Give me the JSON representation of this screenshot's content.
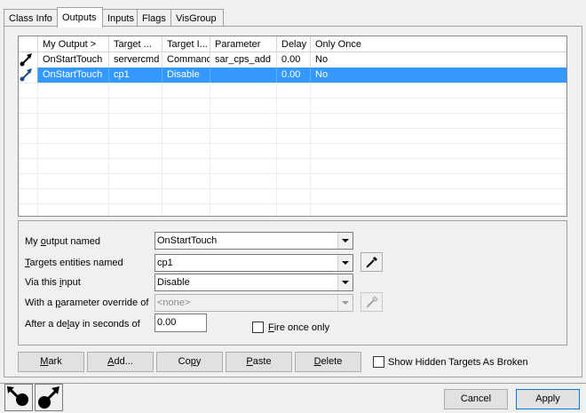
{
  "tabs": [
    {
      "label": "Class Info"
    },
    {
      "label": "Outputs"
    },
    {
      "label": "Inputs"
    },
    {
      "label": "Flags"
    },
    {
      "label": "VisGroup"
    }
  ],
  "active_tab": "Outputs",
  "list": {
    "columns": [
      "",
      "My Output  >",
      "Target ...",
      "Target I...",
      "Parameter",
      "Delay",
      "Only Once"
    ],
    "rows": [
      {
        "output": "OnStartTouch",
        "target": "servercmd",
        "input": "Command",
        "parameter": "sar_cps_add",
        "delay": "0.00",
        "once": "No",
        "selected": false
      },
      {
        "output": "OnStartTouch",
        "target": "cp1",
        "input": "Disable",
        "parameter": "",
        "delay": "0.00",
        "once": "No",
        "selected": true
      }
    ]
  },
  "props": {
    "output_label_pre": "My ",
    "output_label_u": "o",
    "output_label_post": "utput named",
    "output_value": "OnStartTouch",
    "targets_label_u": "T",
    "targets_label_post": "argets entities named",
    "targets_value": "cp1",
    "input_label_pre": "Via this ",
    "input_label_u": "i",
    "input_label_post": "nput",
    "input_value": "Disable",
    "param_label_pre": "With a ",
    "param_label_u": "p",
    "param_label_post": "arameter override of",
    "param_value": "<none>",
    "delay_label_pre": "After a de",
    "delay_label_u": "l",
    "delay_label_post": "ay in seconds of",
    "delay_value": "0.00",
    "fire_once_u": "F",
    "fire_once_post": "ire once only"
  },
  "buttons": {
    "mark_u": "M",
    "mark_post": "ark",
    "add_u": "A",
    "add_post": "dd...",
    "copy_pre": "Co",
    "copy_u": "p",
    "copy_post": "y",
    "paste_u": "P",
    "paste_post": "aste",
    "delete_u": "D",
    "delete_post": "elete",
    "show_hidden": "Show Hidden Targets As Broken"
  },
  "footer": {
    "cancel": "Cancel",
    "apply": "Apply"
  }
}
